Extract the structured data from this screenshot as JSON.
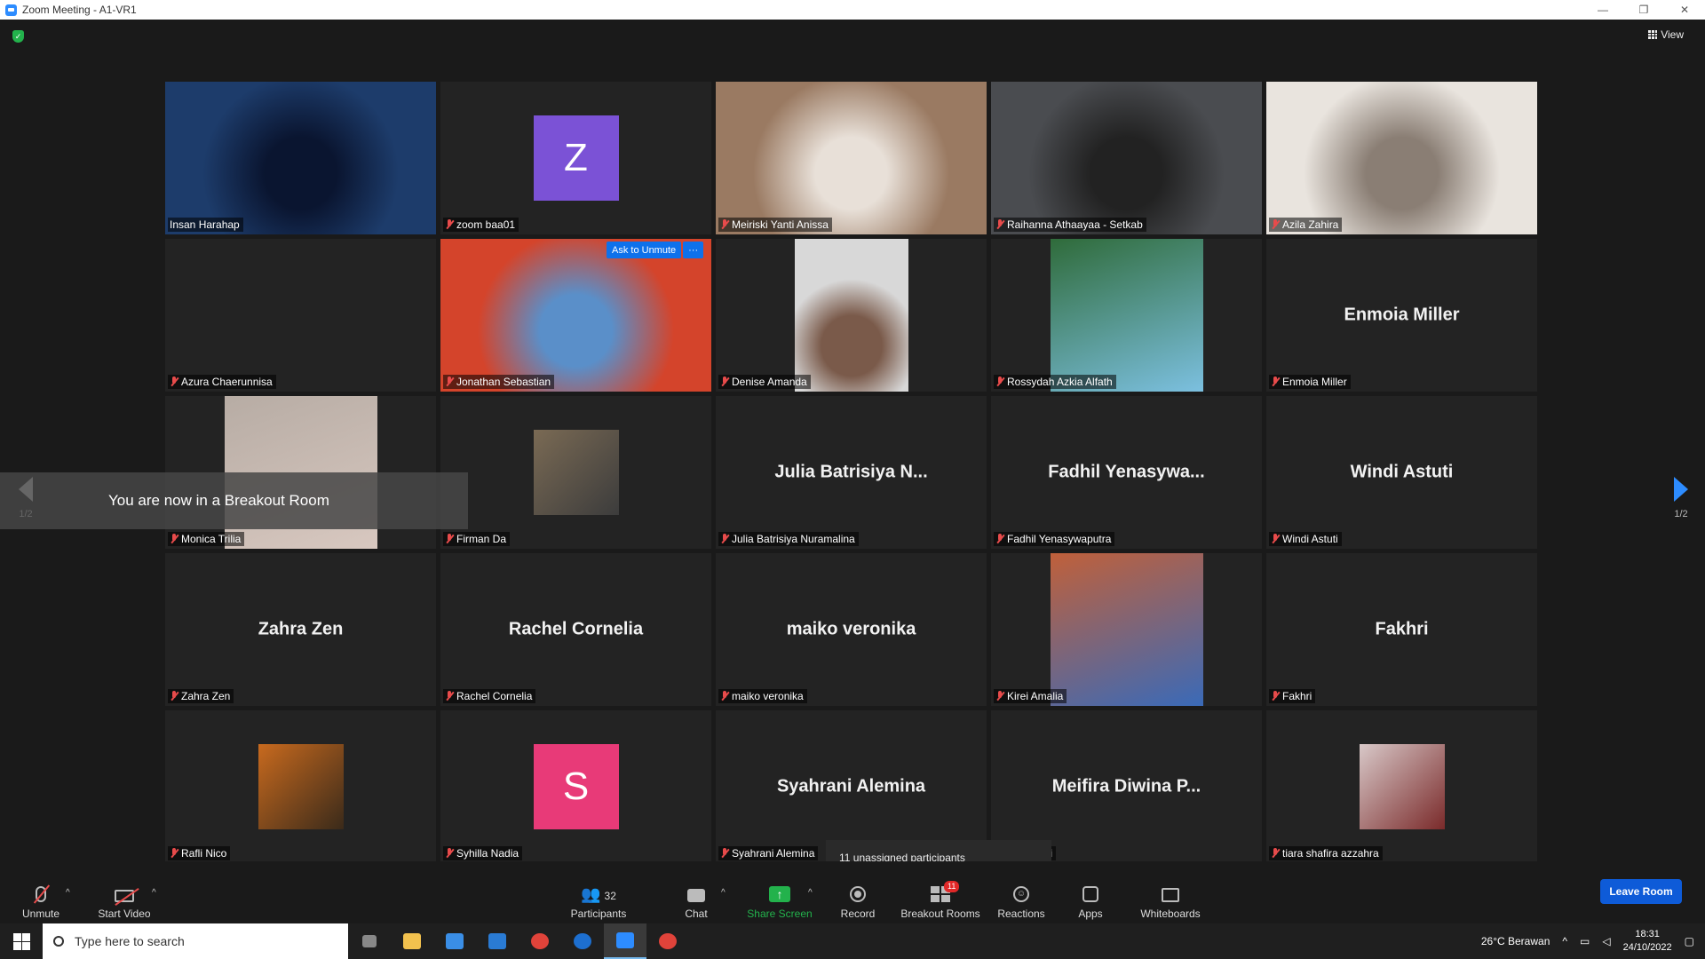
{
  "window": {
    "title": "Zoom Meeting - A1-VR1",
    "minimize": "—",
    "restore": "❐",
    "close": "✕"
  },
  "top": {
    "view_label": "View",
    "shield": "✓"
  },
  "participants": [
    {
      "name": "Insan Harahap",
      "kind": "video",
      "bg": "#1d3c6b",
      "bg2": "#0a1530",
      "muted": false,
      "active": true
    },
    {
      "name": "zoom baa01",
      "kind": "avatar",
      "initial": "Z",
      "bg": "#7b52d6",
      "muted": true
    },
    {
      "name": "Meiriski Yanti Anissa",
      "kind": "video",
      "bg": "#9a7a62",
      "bg2": "#e8e0d8",
      "muted": true
    },
    {
      "name": "Raihanna Athaayaa - Setkab",
      "kind": "video",
      "bg": "#4a4c50",
      "bg2": "#222",
      "muted": true
    },
    {
      "name": "Azila Zahira",
      "kind": "video",
      "bg": "#e9e4de",
      "bg2": "#8a7e74",
      "muted": true
    },
    {
      "name": "Azura Chaerunnisa",
      "kind": "blank",
      "muted": true
    },
    {
      "name": "Jonathan Sebastian",
      "kind": "video",
      "bg": "#d4442b",
      "bg2": "#5a8fc9",
      "muted": true,
      "ask": true
    },
    {
      "name": "Denise Amanda",
      "kind": "video-narrow",
      "bg": "#d8d8d8",
      "bg2": "#7a5a4a",
      "muted": true
    },
    {
      "name": "Rossydah Azkia Alfath",
      "kind": "video-med",
      "bg": "#2f6b3a",
      "bg2": "#7cc0e0",
      "muted": true
    },
    {
      "name": "Enmoia Miller",
      "kind": "name",
      "big": "Enmoia Miller",
      "muted": true
    },
    {
      "name": "Monica Trilia",
      "kind": "video-med",
      "bg": "#b7aca4",
      "bg2": "#d8c8c0",
      "muted": true
    },
    {
      "name": "Firman Da",
      "kind": "photo",
      "bg": "#7a6a54",
      "bg2": "#3c3c3c",
      "muted": true
    },
    {
      "name": "Julia Batrisiya Nuramalina",
      "kind": "name",
      "big": "Julia Batrisiya N...",
      "muted": true
    },
    {
      "name": "Fadhil Yenasywaputra",
      "kind": "name",
      "big": "Fadhil  Yenasywa...",
      "muted": true
    },
    {
      "name": "Windi Astuti",
      "kind": "name",
      "big": "Windi Astuti",
      "muted": true
    },
    {
      "name": "Zahra Zen",
      "kind": "name",
      "big": "Zahra Zen",
      "muted": true
    },
    {
      "name": "Rachel Cornelia",
      "kind": "name",
      "big": "Rachel Cornelia",
      "muted": true
    },
    {
      "name": "maiko veronika",
      "kind": "name",
      "big": "maiko veronika",
      "muted": true
    },
    {
      "name": "Kirei Amalia",
      "kind": "video-med",
      "bg": "#c0603a",
      "bg2": "#3a6ab8",
      "muted": true
    },
    {
      "name": "Fakhri",
      "kind": "name",
      "big": "Fakhri",
      "muted": true
    },
    {
      "name": "Rafli Nico",
      "kind": "photo",
      "bg": "#c86a1e",
      "bg2": "#3a2a1a",
      "muted": true
    },
    {
      "name": "Syhilla Nadia",
      "kind": "avatar",
      "initial": "S",
      "bg": "#e83a78",
      "muted": true
    },
    {
      "name": "Syahrani Alemina",
      "kind": "name",
      "big": "Syahrani Alemina",
      "muted": true
    },
    {
      "name": "Diwina Putri",
      "kind": "name",
      "big": "Meifira Diwina P...",
      "muted": false
    },
    {
      "name": "tiara shafira azzahra",
      "kind": "photo",
      "bg": "#d8c8c8",
      "bg2": "#7a2a2a",
      "muted": true
    }
  ],
  "ask_to_unmute": {
    "label": "Ask to Unmute",
    "more": "···"
  },
  "breakout_toast": "You are now in a Breakout Room",
  "pager": {
    "left": "1/2",
    "right": "1/2"
  },
  "unassigned": "11 unassigned participants",
  "toolbar": {
    "unmute": "Unmute",
    "start_video": "Start Video",
    "participants": "Participants",
    "participants_count": "32",
    "chat": "Chat",
    "share_screen": "Share Screen",
    "record": "Record",
    "breakout_rooms": "Breakout Rooms",
    "breakout_badge": "11",
    "reactions": "Reactions",
    "apps": "Apps",
    "whiteboards": "Whiteboards",
    "leave": "Leave Room",
    "caret": "^"
  },
  "taskbar": {
    "search_placeholder": "Type here to search",
    "weather": "26°C  Berawan",
    "time": "18:31",
    "date": "24/10/2022"
  },
  "colors": {
    "accent": "#2d8cff",
    "active_border": "#e7e56f",
    "mute_red": "#e84b4b",
    "share_green": "#23b24c"
  }
}
